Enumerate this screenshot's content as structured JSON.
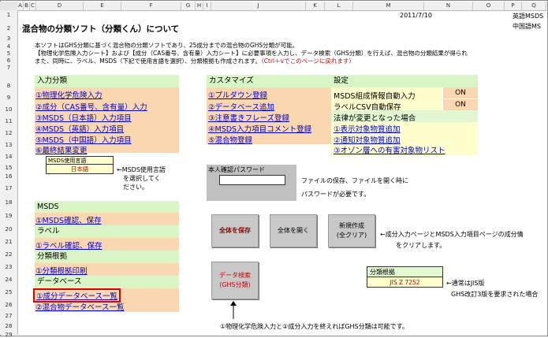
{
  "columns": [
    "A",
    "B",
    "C",
    "D",
    "E",
    "F",
    "G",
    "H",
    "I",
    "J",
    "K",
    "L",
    "M",
    "N",
    "O",
    "P",
    "Q"
  ],
  "rows": [
    "1",
    "2",
    "3",
    "4",
    "5",
    "6",
    "7",
    "8",
    "9",
    "10",
    "11",
    "12",
    "13",
    "14",
    "15",
    "16",
    "17",
    "18",
    "19",
    "20",
    "21",
    "22",
    "23",
    "24",
    "25",
    "26",
    "27",
    "28",
    "29"
  ],
  "date": "2011/7/10",
  "top_right": {
    "line1": "英語MSDS",
    "line2": "中国語MS"
  },
  "title": "混合物の分類ソフト（分類くん）について",
  "desc": {
    "line1": "本ソフトはGHS分類に基づく混合物の分類ソフトであり、25成分までの混合物のGHS分類が可能。",
    "line2": "【物理化学危険入力シート】および【成分（CAS番号、含有量）入力シート】に必要事項を入力し、データ検索（GHS分類）を行えば、混合物の分類結果が得られ",
    "line3a": "また、同時に、ラベル、MSDS（下記で使用言語を選択）、分類根拠も作成されます。",
    "line3b": "（Ctrl＋vでこのページに戻れます）"
  },
  "input": {
    "header": "入力分類",
    "items": [
      "①物理化学危険入力",
      "②成分（CAS番号、含有量）入力",
      "③MSDS（日本語）入力項目",
      "④MSDS（英語）入力項目",
      "⑤MSDS（中国語）入力項目",
      "⑥最終結果変更"
    ]
  },
  "lang": {
    "label": "MSDS使用言語",
    "value": "日本語",
    "note1": "←MSDS使用言語",
    "note2": "を選択してく",
    "note3": "ださい。"
  },
  "customize": {
    "header": "カスタマイズ",
    "items": [
      "①プルダウン登録",
      "②データベース追加",
      "③注意書きフレーズ登録",
      "④MSDS入力項目コメント登録",
      "⑤混合物登録"
    ]
  },
  "settings": {
    "header": "設定",
    "rows": [
      {
        "label": "MSDS組成情報自動入力",
        "value": "ON"
      },
      {
        "label": "ラベルCSV自動保存",
        "value": "ON"
      }
    ]
  },
  "law": {
    "header": "法律が変更となった場合",
    "items": [
      "①表示対象物質追加",
      "②通知対象物質追加",
      "③オゾン層への有害対象物リスト"
    ]
  },
  "password": {
    "label": "本人確認パスワード",
    "value": "",
    "note1": "ファイルの保存、ファイルを開く時に",
    "note2": "パスワードが必要です。"
  },
  "msds": {
    "header": "MSDS",
    "item": "①MSDS確認、保存"
  },
  "label_sec": {
    "header": "ラベル",
    "item": "①ラベル確認、保存"
  },
  "basis": {
    "header": "分類根拠",
    "item": "①分類根拠印刷"
  },
  "database": {
    "header": "データベース",
    "items": [
      "①成分データベース一覧",
      "②混合物データベース一覧"
    ]
  },
  "buttons": {
    "save_all": "全体を保存",
    "open_all": "全体を開く",
    "new1": "新規作成",
    "new2": "(全クリア)",
    "search1": "データ検索",
    "search2": "(GHS分類)"
  },
  "clear_note": {
    "line1": "←成分入力ページとMSDS入力項目ページの成分情",
    "line2": "をクリアします。"
  },
  "basis_box": {
    "label": "分類根拠",
    "value": "JIS Z 7252",
    "note1": "←通常はJIS版",
    "note2": "GHS改訂3版を要求された場合"
  },
  "bottom_note": "①物理化学危険入力と②成分入力を終えればGHS分類は可能です。",
  "colors": {
    "header_green": "#d9f5c6",
    "peach": "#fbd7b1",
    "link_blue": "#0000cc",
    "red": "#cc0000"
  }
}
